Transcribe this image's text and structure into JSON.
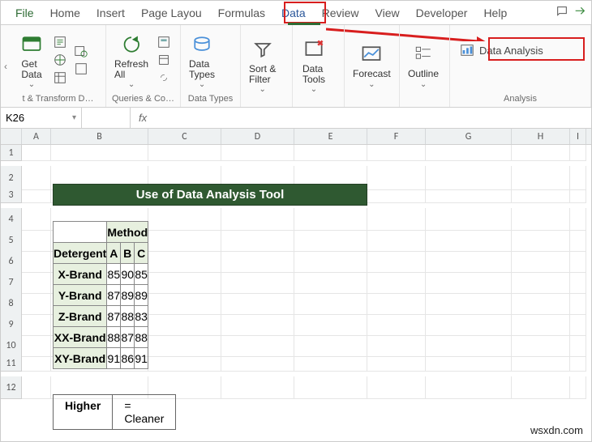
{
  "tabs": {
    "file": "File",
    "home": "Home",
    "insert": "Insert",
    "pagelayout": "Page Layou",
    "formulas": "Formulas",
    "data": "Data",
    "review": "Review",
    "view": "View",
    "developer": "Developer",
    "help": "Help"
  },
  "ribbon": {
    "get_data": "Get\nData",
    "refresh_all": "Refresh\nAll",
    "data_types": "Data\nTypes",
    "sort_filter": "Sort &\nFilter",
    "data_tools": "Data\nTools",
    "forecast": "Forecast",
    "outline": "Outline",
    "data_analysis": "Data Analysis",
    "group_transform": "t & Transform D…",
    "group_queries": "Queries & Co…",
    "group_types": "Data Types",
    "group_analysis": "Analysis"
  },
  "namebox": "K26",
  "formula": "",
  "columns": [
    "A",
    "B",
    "C",
    "D",
    "E",
    "F",
    "G",
    "H",
    "I"
  ],
  "rows": [
    "1",
    "2",
    "3",
    "4",
    "5",
    "6",
    "7",
    "8",
    "9",
    "10",
    "11",
    "12"
  ],
  "banner_title": "Use of Data Analysis Tool",
  "table": {
    "method_header": "Method",
    "detergent_header": "Detergent",
    "cols": [
      "A",
      "B",
      "C"
    ],
    "rows": [
      {
        "label": "X-Brand",
        "vals": [
          "85",
          "90",
          "85"
        ]
      },
      {
        "label": "Y-Brand",
        "vals": [
          "87",
          "89",
          "89"
        ]
      },
      {
        "label": "Z-Brand",
        "vals": [
          "87",
          "88",
          "83"
        ]
      },
      {
        "label": "XX-Brand",
        "vals": [
          "88",
          "87",
          "88"
        ]
      },
      {
        "label": "XY-Brand",
        "vals": [
          "91",
          "86",
          "91"
        ]
      }
    ]
  },
  "note": {
    "label": "Higher",
    "value": "= Cleaner"
  },
  "watermark": "wsxdn.com"
}
